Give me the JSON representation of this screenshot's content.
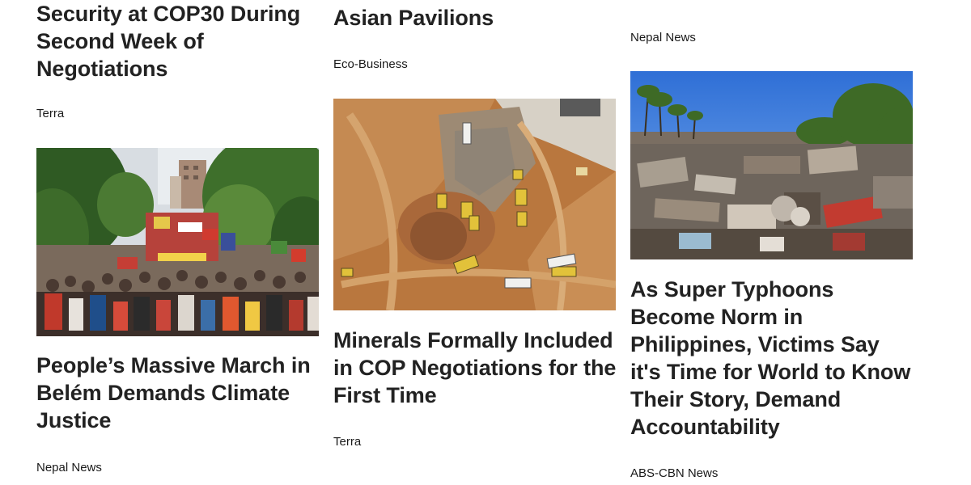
{
  "columns": [
    {
      "articles": [
        {
          "title": "Security at COP30 During Second Week of Negotiations",
          "source": "Terra"
        },
        {
          "title": "People’s Massive March in Belém Demands Climate Justice",
          "source": "Nepal News",
          "image": "protest-march-photo"
        }
      ]
    },
    {
      "articles": [
        {
          "title": "Asian Pavilions",
          "source": "Eco-Business"
        },
        {
          "title": "Minerals Formally Included in COP Negotiations for the First Time",
          "source": "Terra",
          "image": "mining-site-aerial-photo"
        }
      ]
    },
    {
      "articles": [
        {
          "source": "Nepal News"
        },
        {
          "title": "As Super Typhoons Become Norm in Philippines, Victims Say it's Time for World to Know Their Story, Demand Accountability",
          "source": "ABS-CBN News",
          "image": "typhoon-debris-photo"
        }
      ]
    }
  ],
  "colors": {
    "title": "#222222",
    "source": "#1a1a1a",
    "background": "#ffffff"
  }
}
